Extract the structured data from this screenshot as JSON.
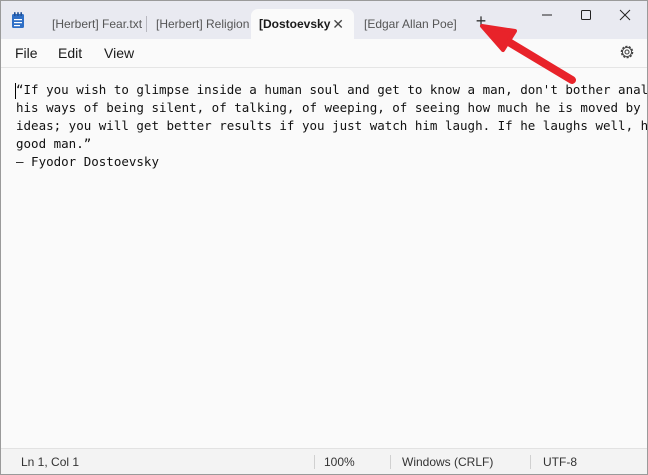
{
  "tabs": [
    {
      "label": "[Herbert] Fear.txt",
      "active": false
    },
    {
      "label": "[Herbert] Religion a",
      "active": false
    },
    {
      "label": "[Dostoevsky",
      "active": true
    },
    {
      "label": "[Edgar Allan Poe] Tl",
      "active": false
    }
  ],
  "menu": {
    "file": "File",
    "edit": "Edit",
    "view": "View"
  },
  "document": {
    "lines": [
      "“If you wish to glimpse inside a human soul and get to know a man, don't bother analyzing",
      "his ways of being silent, of talking, of weeping, of seeing how much he is moved by noble",
      "ideas; you will get better results if you just watch him laugh. If he laughs well, he's a",
      "good man.”",
      "— Fyodor Dostoevsky"
    ]
  },
  "status": {
    "position": "Ln 1, Col 1",
    "zoom": "100%",
    "line_ending": "Windows (CRLF)",
    "encoding": "UTF-8"
  },
  "colors": {
    "annotation_arrow": "#e8232a",
    "titlebar": "#e9eaf1",
    "notepad_icon": "#2f6fc6"
  },
  "icons": [
    "notepad-app-icon",
    "close-tab-icon",
    "plus-icon",
    "minimize-icon",
    "maximize-icon",
    "close-window-icon",
    "gear-icon",
    "red-annotation-arrow"
  ]
}
